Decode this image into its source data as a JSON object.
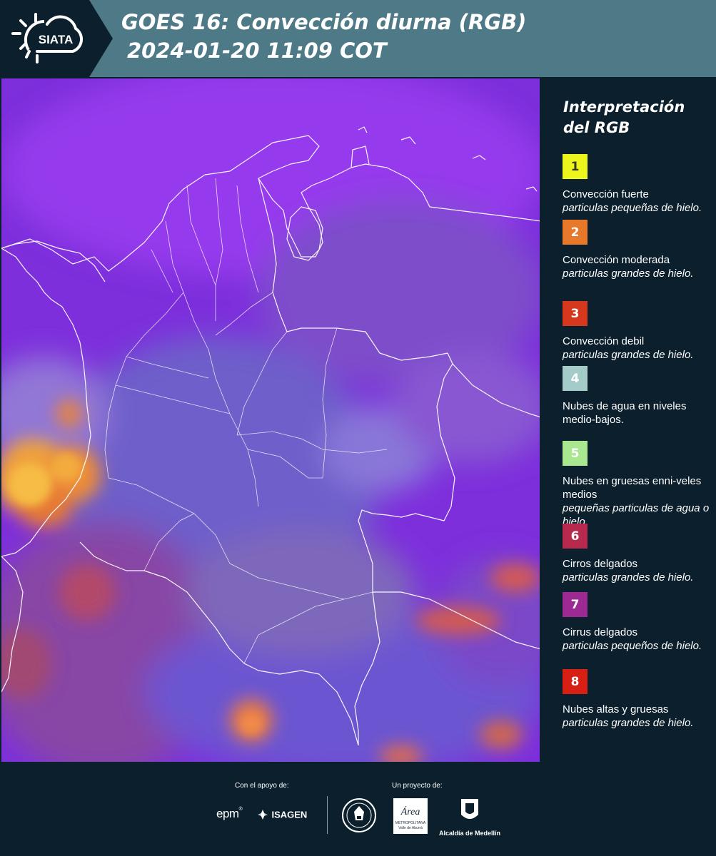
{
  "header": {
    "brand": "SIATA",
    "title_line1": "GOES 16: Convección diurna (RGB)",
    "title_line2": " 2024-01-20 11:09 COT"
  },
  "colors": {
    "header_bg": "#4e7a88",
    "panel_bg": "#0b1f2c",
    "map_base": "#7a2fd8"
  },
  "legend": {
    "title": "Interpretación del RGB",
    "items": [
      {
        "num": "1",
        "color": "#ecf51c",
        "text_color": "#3a3a1a",
        "name": "Convección fuerte",
        "desc": "particulas pequeñas de hielo."
      },
      {
        "num": "2",
        "color": "#e8782a",
        "text_color": "#ffffff",
        "name": "Convección moderada",
        "desc": "particulas grandes de hielo."
      },
      {
        "num": "3",
        "color": "#d6381e",
        "text_color": "#ffffff",
        "name": "Convección debil",
        "desc": "particulas grandes de hielo."
      },
      {
        "num": "4",
        "color": "#a3ccc9",
        "text_color": "#ffffff",
        "name": "Nubes de agua en niveles medio-bajos.",
        "desc": ""
      },
      {
        "num": "5",
        "color": "#a9e88e",
        "text_color": "#ffffff",
        "name": "Nubes en gruesas enni-veles medios",
        "desc": "pequeñas particulas de agua o hielo."
      },
      {
        "num": "6",
        "color": "#b8294e",
        "text_color": "#ffffff",
        "name": "Cirros delgados",
        "desc": "particulas grandes de hielo."
      },
      {
        "num": "7",
        "color": "#9c2a92",
        "text_color": "#ffffff",
        "name": "Cirrus delgados",
        "desc": "particulas pequeños de hielo."
      },
      {
        "num": "8",
        "color": "#d71f14",
        "text_color": "#ffffff",
        "name": "Nubes altas y gruesas",
        "desc": "particulas grandes de hielo."
      }
    ]
  },
  "footer": {
    "support_label": "Con el apoyo de:",
    "project_label": "Un proyecto de:",
    "epm_text": "epm",
    "isagen_text": "ISAGEN",
    "area_text": "Área",
    "area_sub1": "METROPOLITANA",
    "area_sub2": "Valle de Aburrá",
    "alcaldia_text": "Alcaldía de Medellín"
  }
}
